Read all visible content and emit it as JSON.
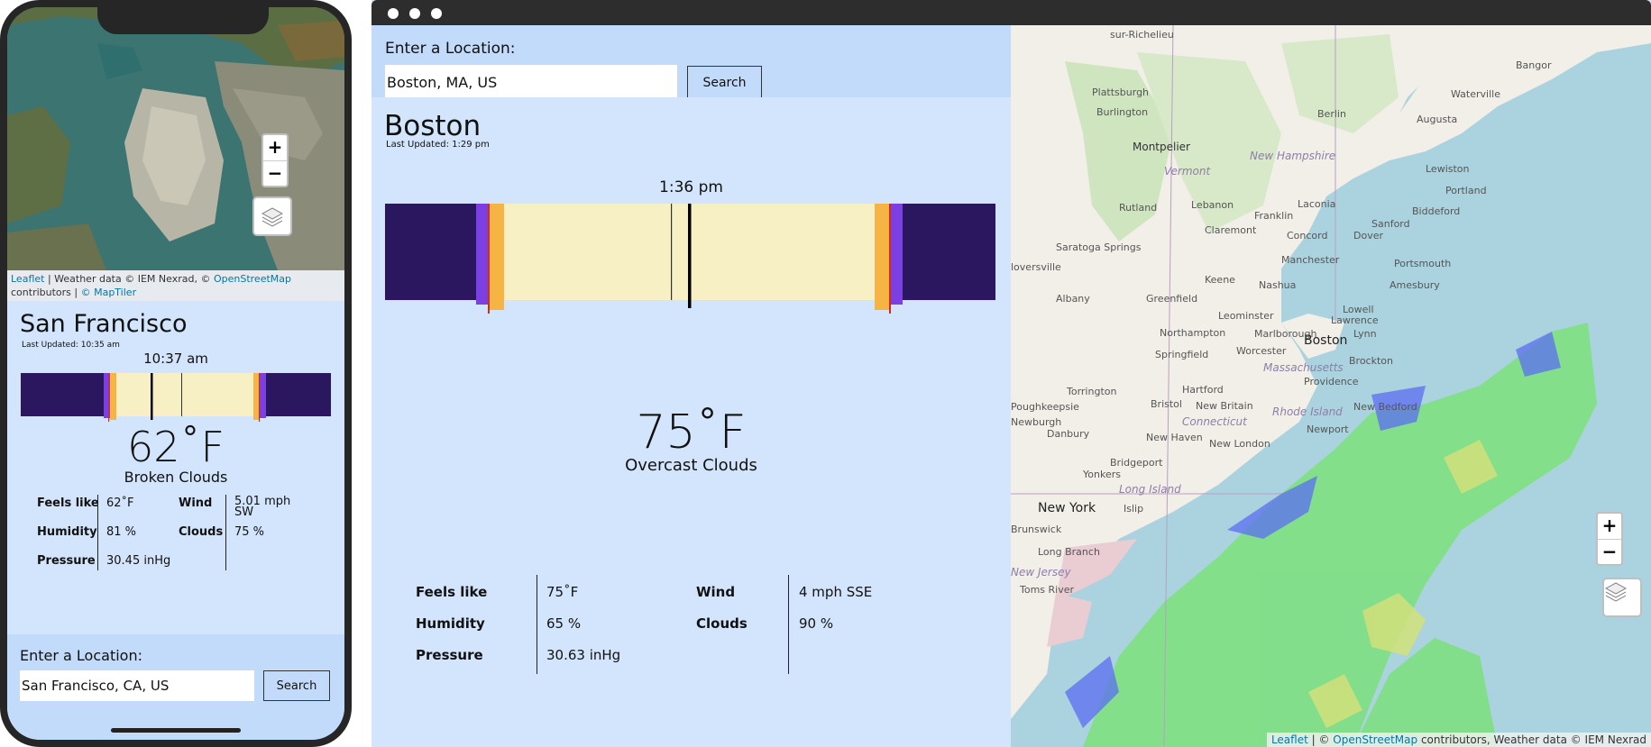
{
  "phone": {
    "map_attribution": {
      "leaflet": "Leaflet",
      "sep1": " | Weather data © IEM Nexrad, © ",
      "osm": "OpenStreetMap",
      "mid": " contributors | ",
      "maptiler": "© MapTiler"
    },
    "zoom_in": "+",
    "zoom_out": "−",
    "weather": {
      "city": "San Francisco",
      "last_updated": "Last Updated: 10:35 am",
      "current_time": "10:37 am",
      "temperature": "62˚F",
      "condition": "Broken Clouds",
      "details": {
        "feels_like_label": "Feels like",
        "feels_like": "62˚F",
        "humidity_label": "Humidity",
        "humidity": "81 %",
        "pressure_label": "Pressure",
        "pressure": "30.45 inHg",
        "wind_label": "Wind",
        "wind": "5.01 mph",
        "wind_dir": "SW",
        "clouds_label": "Clouds",
        "clouds": "75 %"
      }
    },
    "search": {
      "label": "Enter a Location:",
      "value": "San Francisco, CA, US",
      "button": "Search"
    }
  },
  "desktop": {
    "search": {
      "label": "Enter a Location:",
      "value": "Boston, MA, US",
      "button": "Search"
    },
    "weather": {
      "city": "Boston",
      "last_updated": "Last Updated: 1:29 pm",
      "current_time": "1:36 pm",
      "temperature": "75˚F",
      "condition": "Overcast Clouds",
      "details": {
        "feels_like_label": "Feels like",
        "feels_like": "75˚F",
        "humidity_label": "Humidity",
        "humidity": "65 %",
        "pressure_label": "Pressure",
        "pressure": "30.63 inHg",
        "wind_label": "Wind",
        "wind": "4 mph SSE",
        "clouds_label": "Clouds",
        "clouds": "90 %"
      }
    },
    "map": {
      "zoom_in": "+",
      "zoom_out": "−",
      "attribution": {
        "leaflet": "Leaflet",
        "sep1": " | © ",
        "osm": "OpenStreetMap",
        "rest": " contributors, Weather data © IEM Nexrad"
      },
      "labels": [
        "sur-Richelieu",
        "Bangor",
        "Plattsburgh",
        "Waterville",
        "Montpelier",
        "Augusta",
        "Burlington",
        "Berlin",
        "New Hampshire",
        "Vermont",
        "Lewiston",
        "Portland",
        "Rutland",
        "Lebanon",
        "Franklin",
        "Laconia",
        "Sanford",
        "Biddeford",
        "Claremont",
        "Concord",
        "Dover",
        "Saratoga Springs",
        "Manchester",
        "Portsmouth",
        "loversville",
        "Keene",
        "Nashua",
        "Amesbury",
        "Albany",
        "Greenfield",
        "Leominster",
        "Lowell",
        "Lawrence",
        "Northampton",
        "Marlborough",
        "Lynn",
        "Springfield",
        "Worcester",
        "Boston",
        "Massachusetts",
        "Brockton",
        "Torrington",
        "Hartford",
        "Providence",
        "Poughkeepsie",
        "Bristol",
        "New Britain",
        "Rhode Island",
        "New Bedford",
        "Newburgh",
        "Connecticut",
        "Danbury",
        "New Haven",
        "Newport",
        "New London",
        "Yonkers",
        "Bridgeport",
        "Long Island",
        "New York",
        "Islip",
        "Brunswick",
        "Long Branch",
        "New Jersey",
        "Toms River"
      ]
    }
  }
}
